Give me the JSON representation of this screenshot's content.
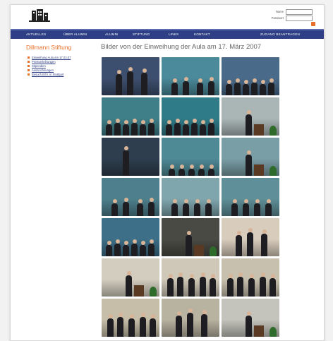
{
  "header": {
    "logo_icon": "building-logo-icon",
    "name_label": "Name",
    "password_label": "Passwort"
  },
  "nav": [
    "AKTUELLES",
    "ÜBER ALUMNI",
    "ALUMNI",
    "STIFTUNG",
    "LINKS",
    "KONTAKT",
    "ZUGANG BEANTRAGEN"
  ],
  "brand": "Dillmann Stiftung",
  "title": "Bilder von der Einweihung der Aula am 17. März 2007",
  "sidebar": {
    "items": [
      "Einweihung Aula am 17.03.07",
      "Preisverleihungen",
      "Stipendien",
      "Auszeichnungen",
      "Besuch Erhr. in Stuttgart"
    ]
  },
  "gallery": {
    "photo_count": 21,
    "photos": [
      {
        "bg": "#3d4f6e",
        "scene": "group3"
      },
      {
        "bg": "#4b8a9a",
        "scene": "seated"
      },
      {
        "bg": "#4a6a8a",
        "scene": "audience"
      },
      {
        "bg": "#3f7f88",
        "scene": "audience"
      },
      {
        "bg": "#2f7b88",
        "scene": "audience"
      },
      {
        "bg": "#aab6b6",
        "scene": "speaker"
      },
      {
        "bg": "#2e3e4e",
        "scene": "portrait"
      },
      {
        "bg": "#4e8a96",
        "scene": "hall"
      },
      {
        "bg": "#7a9ea6",
        "scene": "speaker"
      },
      {
        "bg": "#4d7f8c",
        "scene": "seated"
      },
      {
        "bg": "#7fa6ad",
        "scene": "musicians"
      },
      {
        "bg": "#5f8f98",
        "scene": "musicians"
      },
      {
        "bg": "#3d6f88",
        "scene": "audience"
      },
      {
        "bg": "#4a4a44",
        "scene": "speaker"
      },
      {
        "bg": "#d8ccbc",
        "scene": "group3"
      },
      {
        "bg": "#d2cdbf",
        "scene": "speaker"
      },
      {
        "bg": "#cfc8b8",
        "scene": "group5"
      },
      {
        "bg": "#c8c0ae",
        "scene": "group5"
      },
      {
        "bg": "#c6bea8",
        "scene": "group5"
      },
      {
        "bg": "#b8b2a0",
        "scene": "group3"
      },
      {
        "bg": "#c4c4bc",
        "scene": "speaker"
      }
    ]
  }
}
